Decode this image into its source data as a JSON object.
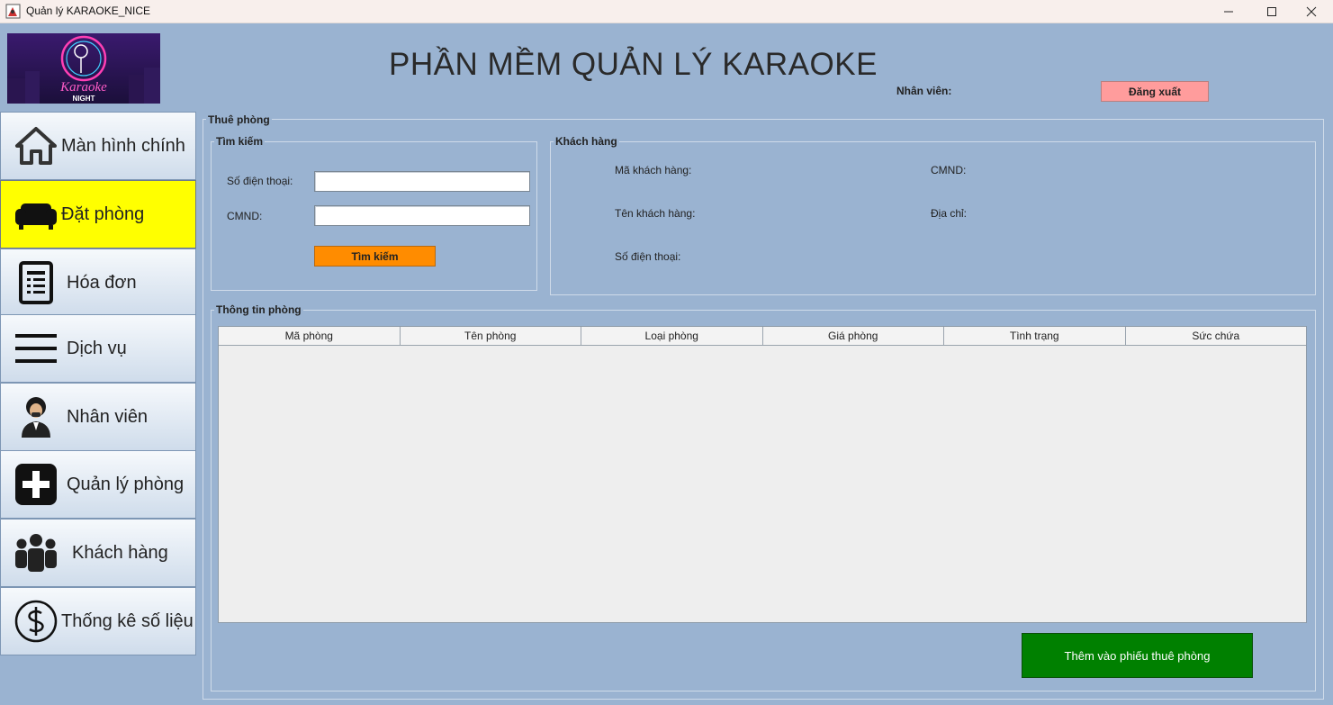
{
  "window": {
    "title": "Quản lý KARAOKE_NICE"
  },
  "header": {
    "logo_text": "Karaoke",
    "logo_subtext": "NIGHT",
    "heading": "PHẦN MỀM QUẢN LÝ KARAOKE",
    "staff_label": "Nhân viên:",
    "logout_label": "Đăng xuất"
  },
  "sidebar": {
    "items": [
      {
        "label": "Màn hình chính",
        "icon": "home-icon"
      },
      {
        "label": "Đặt phòng",
        "icon": "sofa-icon",
        "active": true
      },
      {
        "label": "Hóa đơn",
        "icon": "invoice-icon"
      },
      {
        "label": "Dịch vụ",
        "icon": "menu-icon"
      },
      {
        "label": "Nhân viên",
        "icon": "employee-icon"
      },
      {
        "label": "Quản lý phòng",
        "icon": "plus-icon"
      },
      {
        "label": "Khách hàng",
        "icon": "group-icon"
      },
      {
        "label": "Thống kê số liệu",
        "icon": "dollar-icon"
      }
    ]
  },
  "main": {
    "title": "Thuê phòng",
    "search": {
      "title": "Tìm kiếm",
      "phone_label": "Số điện thoại:",
      "phone_value": "",
      "id_label": "CMND:",
      "id_value": "",
      "button_label": "Tìm kiếm"
    },
    "customer": {
      "title": "Khách hàng",
      "code_label": "Mã khách hàng:",
      "name_label": "Tên khách hàng:",
      "phone_label": "Số điện thoại:",
      "id_label": "CMND:",
      "address_label": "Địa chỉ:"
    },
    "rooms": {
      "title": "Thông tin phòng",
      "columns": [
        "Mã phòng",
        "Tên phòng",
        "Loại phòng",
        "Giá phòng",
        "Tình trạng",
        "Sức chứa"
      ],
      "rows": []
    },
    "add_button_label": "Thêm vào phiếu thuê phòng"
  },
  "colors": {
    "background": "#9ab3d1",
    "active_nav": "#ffff00",
    "logout": "#ff9c9c",
    "search_button": "#ff8c00",
    "add_button": "#008000"
  }
}
